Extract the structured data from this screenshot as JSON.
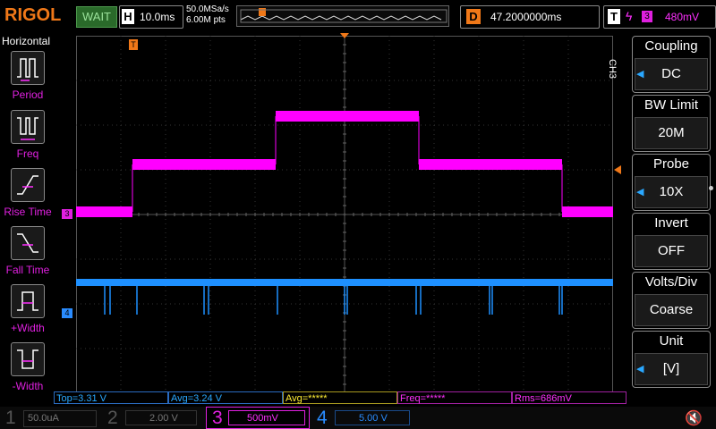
{
  "brand": "RIGOL",
  "run_status": "WAIT",
  "timebase": {
    "chip": "H",
    "value": "10.0ms"
  },
  "acquisition": {
    "sample_rate": "50.0MSa/s",
    "memory_depth": "6.00M pts"
  },
  "delay": {
    "chip": "D",
    "value": "47.2000000ms"
  },
  "trigger": {
    "chip": "T",
    "source_chip": "3",
    "level": "480mV"
  },
  "left_panel": {
    "title": "Horizontal",
    "items": [
      {
        "label": "Period",
        "icon": "period-icon"
      },
      {
        "label": "Freq",
        "icon": "frequency-icon"
      },
      {
        "label": "Rise Time",
        "icon": "rise-time-icon"
      },
      {
        "label": "Fall Time",
        "icon": "fall-time-icon"
      },
      {
        "label": "+Width",
        "icon": "positive-width-icon"
      },
      {
        "label": "-Width",
        "icon": "negative-width-icon"
      }
    ]
  },
  "right_panel": {
    "channel_tag": "CH3",
    "menus": [
      {
        "title": "Coupling",
        "value": "DC",
        "arrow": true
      },
      {
        "title": "BW Limit",
        "value": "20M",
        "arrow": false
      },
      {
        "title": "Probe",
        "value": "10X",
        "arrow": true
      },
      {
        "title": "Invert",
        "value": "OFF",
        "arrow": false
      },
      {
        "title": "Volts/Div",
        "value": "Coarse",
        "arrow": false
      },
      {
        "title": "Unit",
        "value": "[V]",
        "arrow": true
      }
    ]
  },
  "measurements": [
    {
      "text": "Top=3.31 V"
    },
    {
      "text": "Avg=3.24 V"
    },
    {
      "text": "Avg=*****"
    },
    {
      "text": "Freq=*****"
    },
    {
      "text": "Rms=686mV"
    }
  ],
  "channels": [
    {
      "num": "1",
      "scale": "50.0uA",
      "color": "#555555"
    },
    {
      "num": "2",
      "scale": "2.00 V",
      "color": "#555555"
    },
    {
      "num": "3",
      "scale": "500mV",
      "color": "#e020e0"
    },
    {
      "num": "4",
      "scale": "5.00 V",
      "color": "#2a8cff"
    }
  ],
  "waveforms": {
    "ch3_color": "#ff00ff",
    "ch4_color": "#1e90ff",
    "ch3_marker": "3",
    "ch4_marker": "4",
    "trigger_marker": "T"
  }
}
